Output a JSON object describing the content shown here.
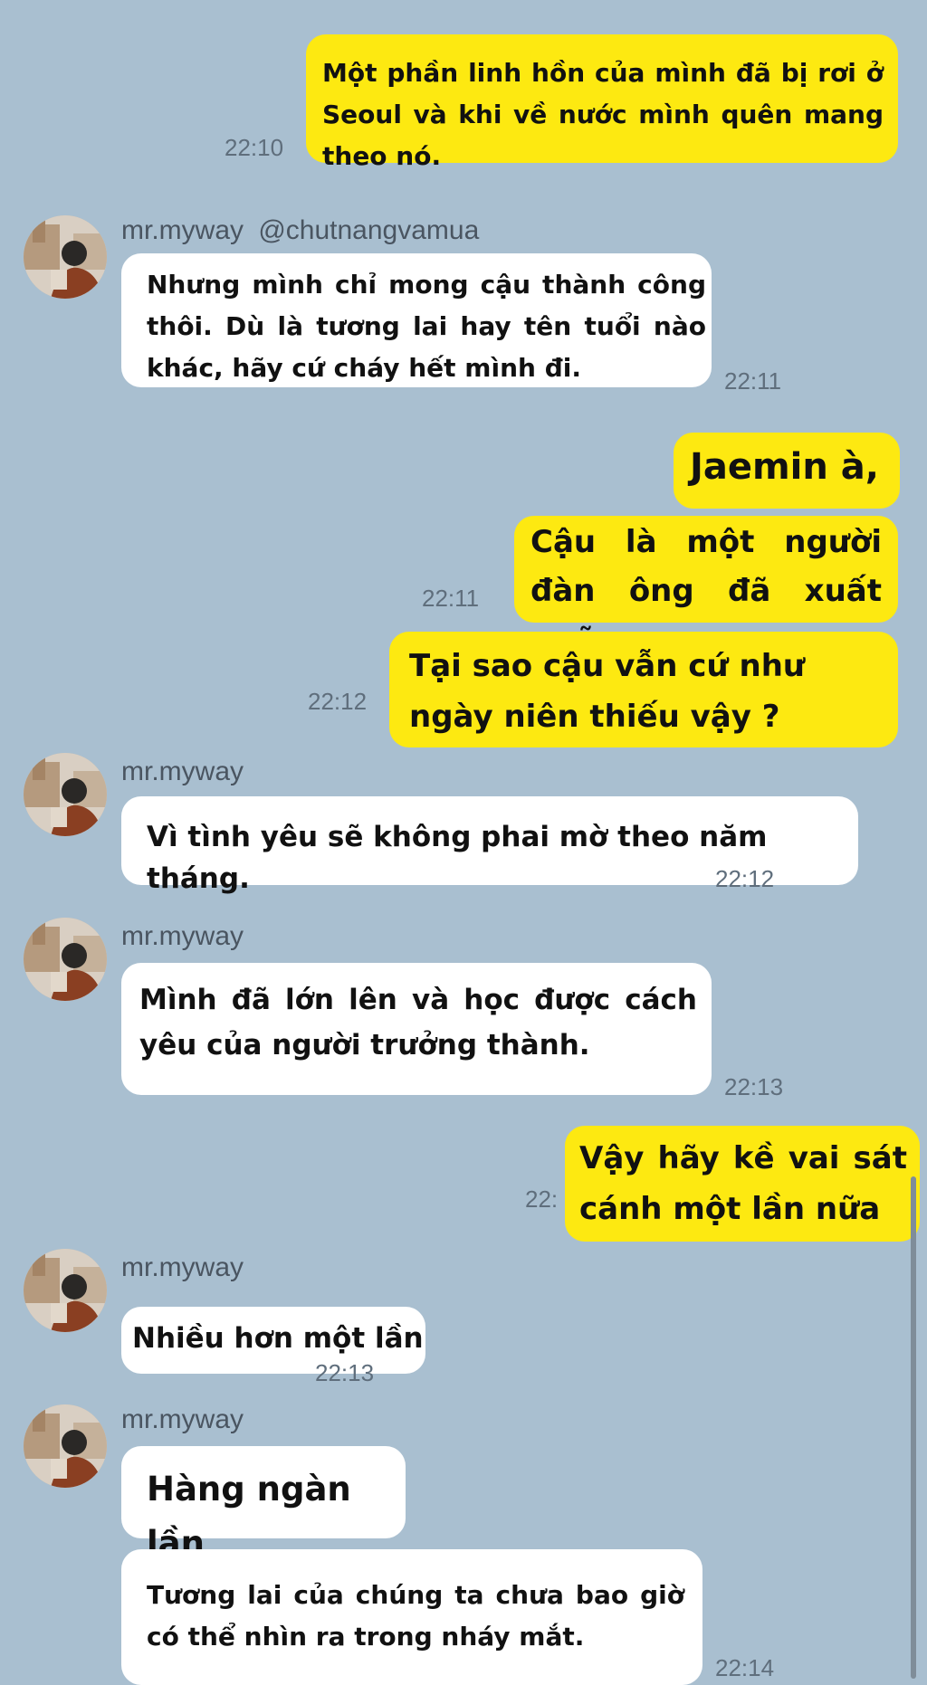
{
  "colors": {
    "background": "#a9bfd0",
    "outgoing": "#fde911",
    "incoming": "#ffffff",
    "time": "#5f6e7c"
  },
  "contact": {
    "name": "mr.myway",
    "mention": "@chutnangvamua"
  },
  "messages": {
    "m1": {
      "text": "Một phần linh hồn của mình đã bị rơi ở Seoul và khi về nước mình quên mang theo nó.",
      "time": "22:10"
    },
    "m2": {
      "text": "Nhưng mình chỉ mong cậu thành công thôi. Dù là tương lai hay tên tuổi nào khác, hãy cứ cháy hết mình đi.",
      "time": "22:11"
    },
    "m3": {
      "text": "Jaemin à,"
    },
    "m4": {
      "text": "Cậu là một người đàn ông đã xuất ngũ",
      "time": "22:11"
    },
    "m5": {
      "text": "Tại sao cậu vẫn cứ như ngày niên thiếu vậy ?",
      "time": "22:12"
    },
    "m6": {
      "text": "Vì tình yêu sẽ không phai mờ theo năm tháng.",
      "time": "22:12"
    },
    "m7": {
      "text": "Mình đã lớn lên và học được cách yêu của người trưởng thành.",
      "time": "22:13"
    },
    "m8": {
      "text": "Vậy hãy kề vai sát cánh một lần nữa",
      "time": "22:"
    },
    "m9": {
      "text": "Nhiều hơn một lần",
      "time": "22:13"
    },
    "m10": {
      "text": "Hàng ngàn lần"
    },
    "m11": {
      "text": "Tương lai của chúng ta chưa bao giờ có thể nhìn ra trong nháy mắt.",
      "time": "22:14"
    }
  }
}
